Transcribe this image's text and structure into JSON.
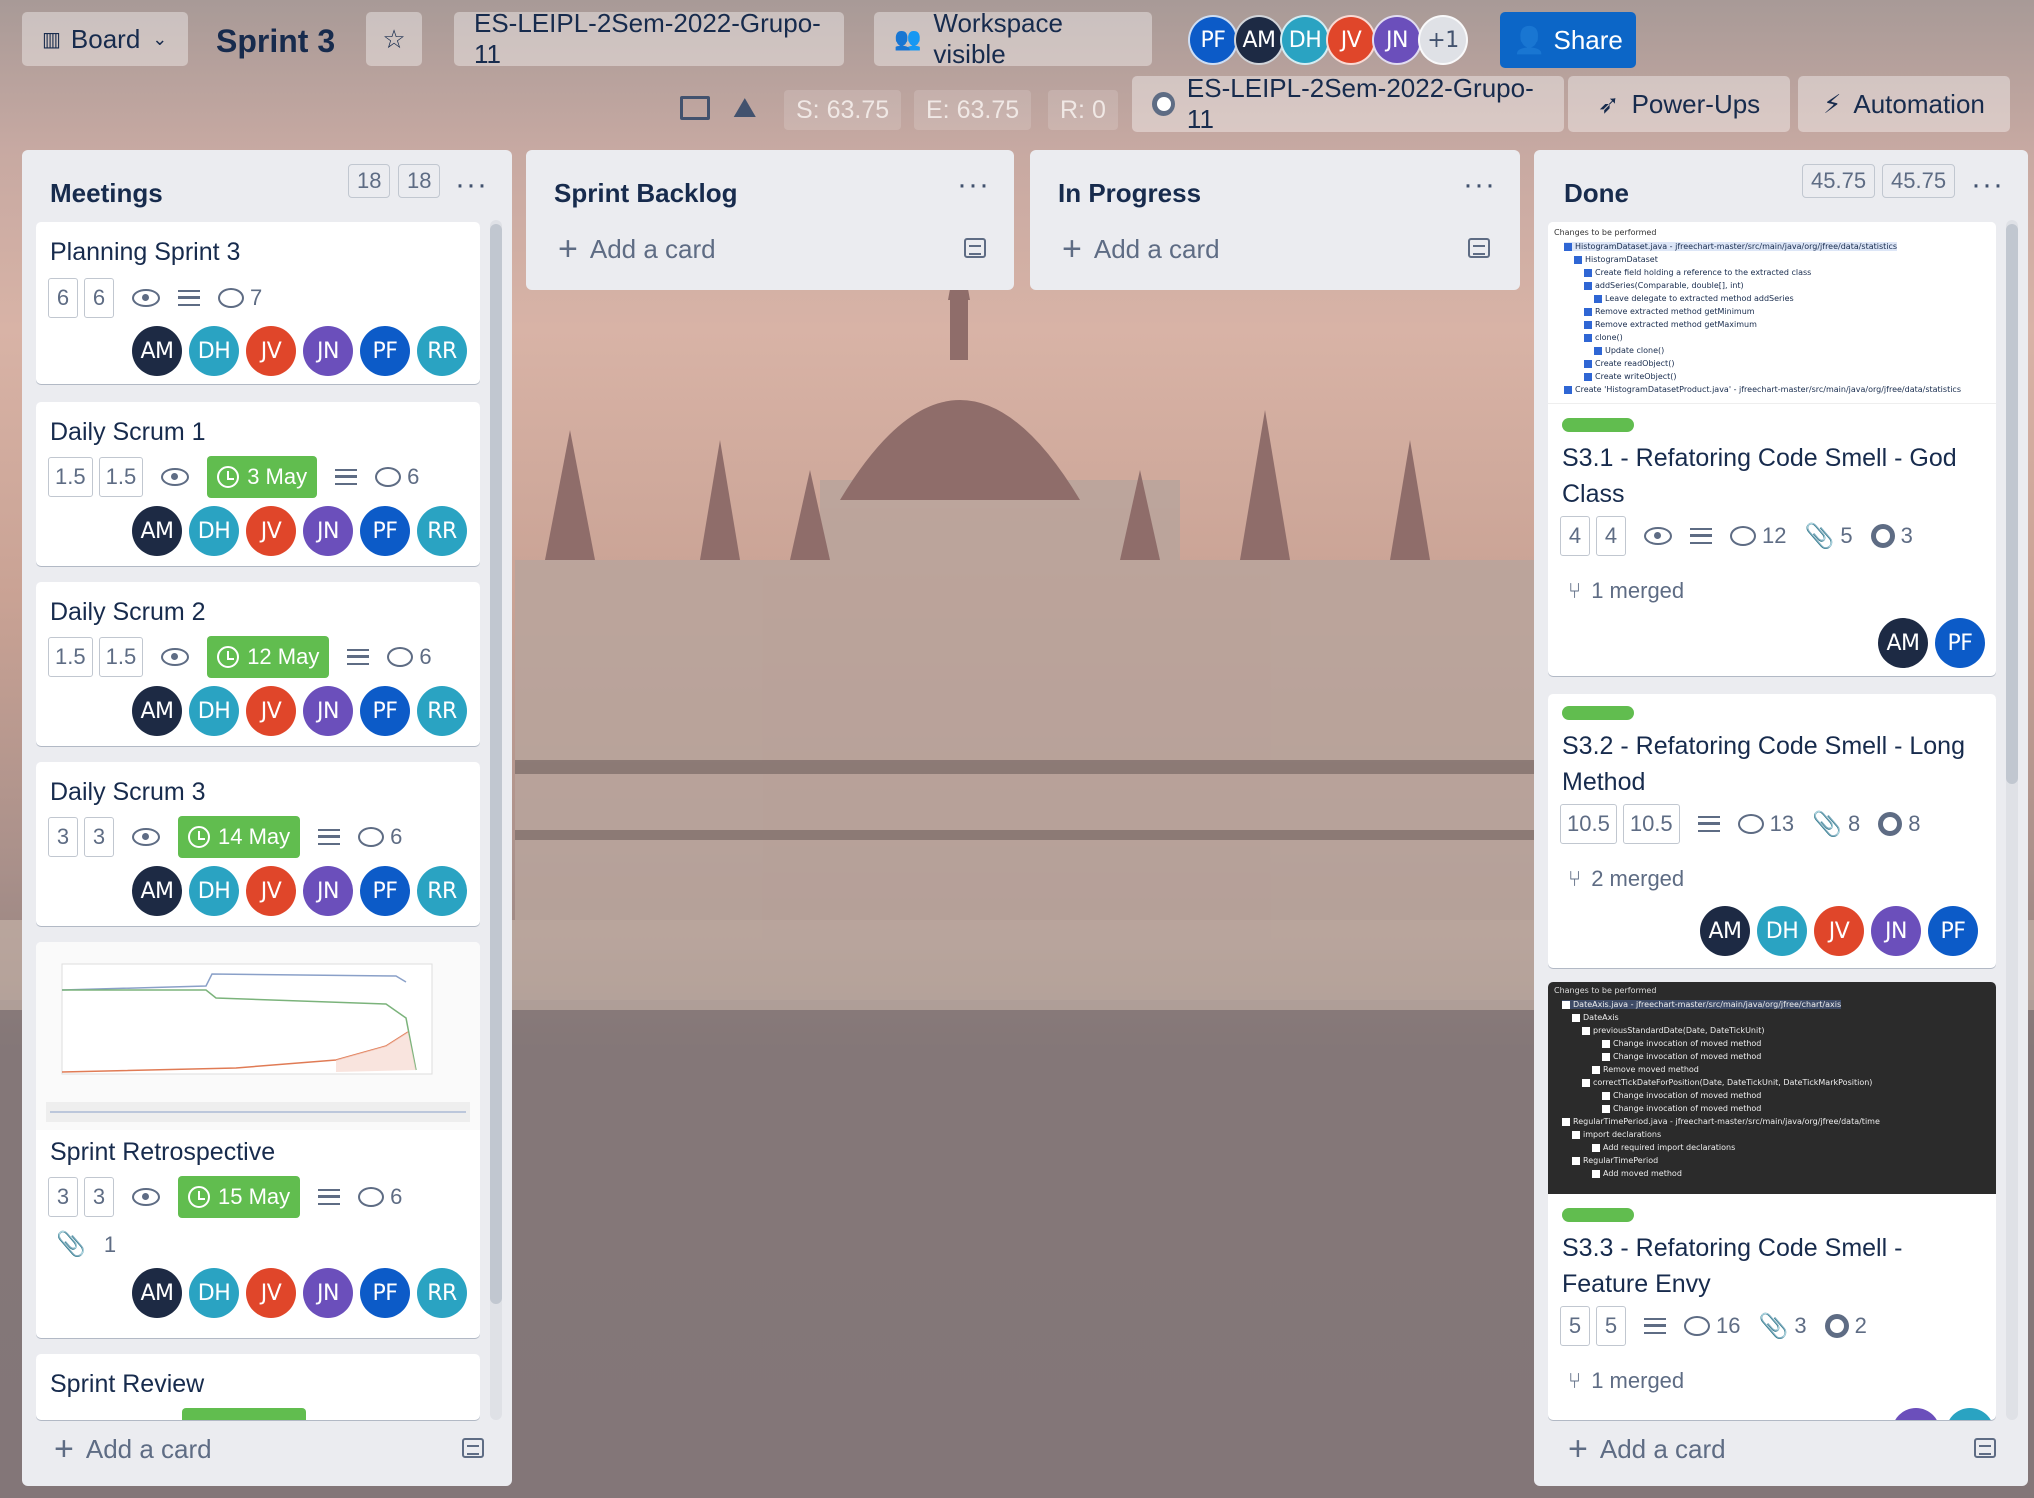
{
  "header": {
    "board_label": "Board",
    "board_name": "Sprint 3",
    "workspace": "ES-LEIPL-2Sem-2022-Grupo-11",
    "visibility": "Workspace visible",
    "share": "Share",
    "extra_members": "+1",
    "members": [
      {
        "initials": "PF",
        "color": "#0c5bc8"
      },
      {
        "initials": "AM",
        "color": "#1d2a44"
      },
      {
        "initials": "DH",
        "color": "#2aa3c2"
      },
      {
        "initials": "JV",
        "color": "#e0462a"
      },
      {
        "initials": "JN",
        "color": "#6b4fbb"
      }
    ]
  },
  "subheader": {
    "stat_s": "S: 63.75",
    "stat_e": "E: 63.75",
    "stat_r": "R: 0",
    "repo": "ES-LEIPL-2Sem-2022-Grupo-11",
    "power_ups": "Power-Ups",
    "automation": "Automation"
  },
  "lists": {
    "meetings": {
      "title": "Meetings",
      "count_a": "18",
      "count_b": "18",
      "add": "Add a card"
    },
    "backlog": {
      "title": "Sprint Backlog",
      "add": "Add a card"
    },
    "progress": {
      "title": "In Progress",
      "add": "Add a card"
    },
    "done": {
      "title": "Done",
      "count_a": "45.75",
      "count_b": "45.75",
      "add": "Add a card"
    }
  },
  "meeting_cards": [
    {
      "title": "Planning Sprint 3",
      "est_a": "6",
      "est_b": "6",
      "comments": "7"
    },
    {
      "title": "Daily Scrum 1",
      "est_a": "1.5",
      "est_b": "1.5",
      "due": "3 May",
      "comments": "6"
    },
    {
      "title": "Daily Scrum 2",
      "est_a": "1.5",
      "est_b": "1.5",
      "due": "12 May",
      "comments": "6"
    },
    {
      "title": "Daily Scrum 3",
      "est_a": "3",
      "est_b": "3",
      "due": "14 May",
      "comments": "6"
    },
    {
      "title": "Sprint Retrospective",
      "est_a": "3",
      "est_b": "3",
      "due": "15 May",
      "comments": "6",
      "attachments": "1"
    },
    {
      "title": "Sprint Review"
    }
  ],
  "meeting_members": [
    {
      "initials": "AM",
      "color": "#1d2a44"
    },
    {
      "initials": "DH",
      "color": "#2aa3c2"
    },
    {
      "initials": "JV",
      "color": "#e0462a"
    },
    {
      "initials": "JN",
      "color": "#6b4fbb"
    },
    {
      "initials": "PF",
      "color": "#0c5bc8"
    },
    {
      "initials": "RR",
      "color": "#2aa3c2"
    }
  ],
  "done_cards": [
    {
      "title": "S3.1 - Refatoring Code Smell - God Class",
      "est_a": "4",
      "est_b": "4",
      "comments": "12",
      "attachments": "5",
      "github": "3",
      "merged": "1 merged"
    },
    {
      "title": "S3.2 - Refatoring Code Smell - Long Method",
      "est_a": "10.5",
      "est_b": "10.5",
      "comments": "13",
      "attachments": "8",
      "github": "8",
      "merged": "2 merged"
    },
    {
      "title": "S3.3 - Refatoring Code Smell - Feature Envy",
      "est_a": "5",
      "est_b": "5",
      "comments": "16",
      "attachments": "3",
      "github": "2",
      "merged": "1 merged"
    }
  ],
  "thumb1": {
    "heading": "Changes to be performed",
    "lines": [
      "HistogramDataset.java - jfreechart-master/src/main/java/org/jfree/data/statistics",
      "HistogramDataset",
      "Create field holding a reference to the extracted class",
      "addSeries(Comparable, double[], int)",
      "Leave delegate to extracted method addSeries",
      "Remove extracted method getMinimum",
      "Remove extracted method getMaximum",
      "clone()",
      "Update clone()",
      "Create readObject()",
      "Create writeObject()",
      "Create 'HistogramDatasetProduct.java' - jfreechart-master/src/main/java/org/jfree/data/statistics"
    ]
  },
  "thumb3": {
    "heading": "Changes to be performed",
    "lines": [
      "DateAxis.java - jfreechart-master/src/main/java/org/jfree/chart/axis",
      "DateAxis",
      "previousStandardDate(Date, DateTickUnit)",
      "Change invocation of moved method",
      "Change invocation of moved method",
      "Remove moved method",
      "correctTickDateForPosition(Date, DateTickUnit, DateTickMarkPosition)",
      "Change invocation of moved method",
      "Change invocation of moved method",
      "RegularTimePeriod.java - jfreechart-master/src/main/java/org/jfree/data/time",
      "import declarations",
      "Add required import declarations",
      "RegularTimePeriod",
      "Add moved method"
    ]
  }
}
